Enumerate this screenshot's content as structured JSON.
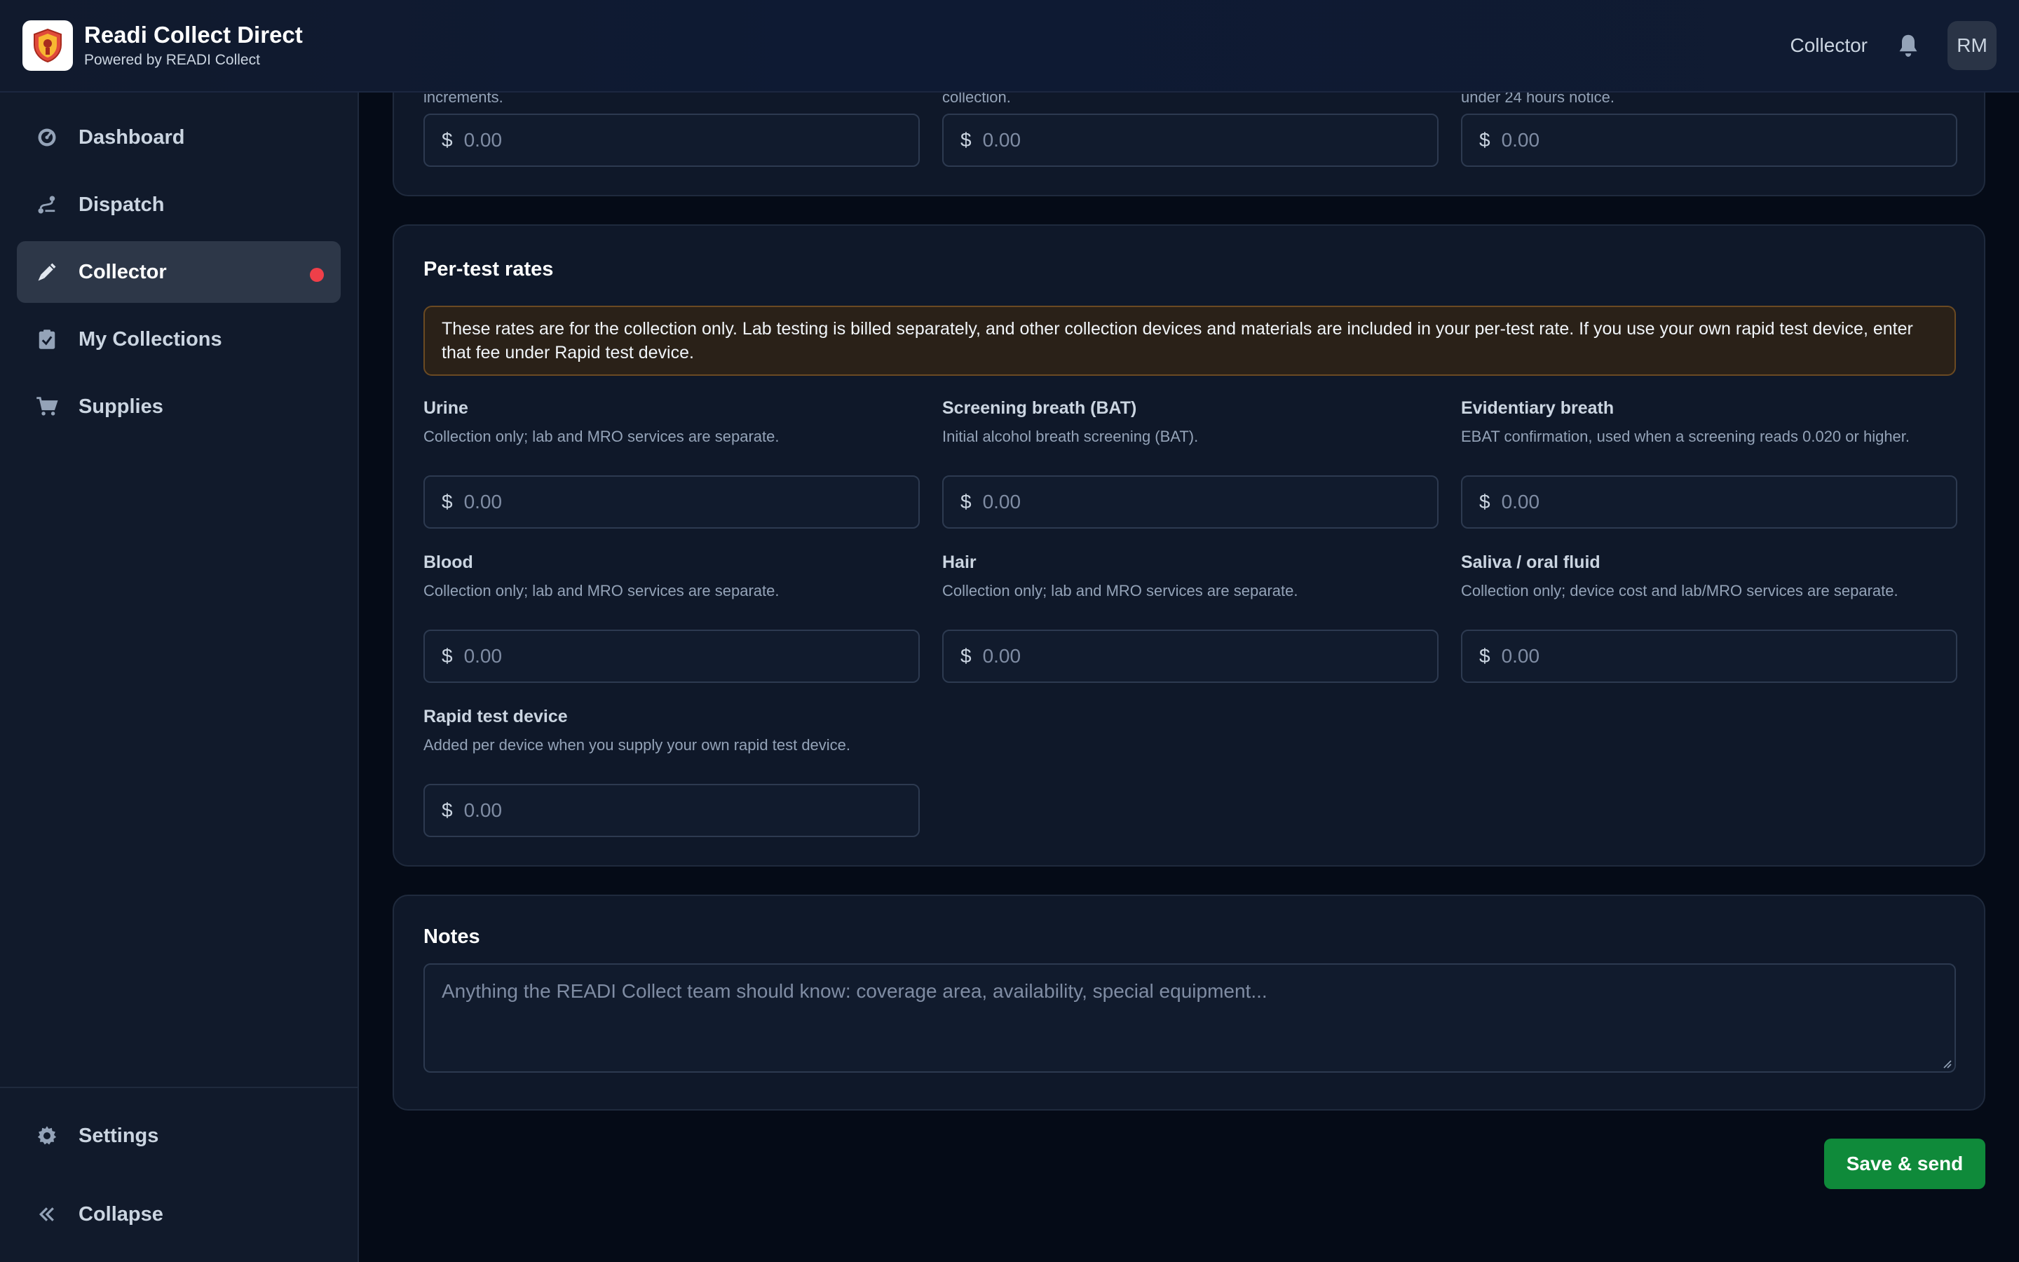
{
  "header": {
    "app_title": "Readi Collect Direct",
    "app_subtitle": "Powered by READI Collect",
    "role": "Collector",
    "avatar_initials": "RM"
  },
  "sidebar": {
    "items": [
      {
        "label": "Dashboard",
        "icon": "gauge-icon"
      },
      {
        "label": "Dispatch",
        "icon": "route-icon"
      },
      {
        "label": "Collector",
        "icon": "syringe-icon",
        "active": true,
        "has_alert_dot": true
      },
      {
        "label": "My Collections",
        "icon": "clipboard-check-icon"
      },
      {
        "label": "Supplies",
        "icon": "cart-icon"
      }
    ],
    "bottom_items": [
      {
        "label": "Settings",
        "icon": "gear-icon"
      },
      {
        "label": "Collapse",
        "icon": "double-chevron-left-icon"
      }
    ]
  },
  "top_section": {
    "help_fragments": [
      "increments.",
      "collection.",
      "under 24 hours notice."
    ],
    "inputs": [
      {
        "currency": "$",
        "placeholder": "0.00"
      },
      {
        "currency": "$",
        "placeholder": "0.00"
      },
      {
        "currency": "$",
        "placeholder": "0.00"
      }
    ]
  },
  "per_test": {
    "title": "Per-test rates",
    "notice": "These rates are for the collection only. Lab testing is billed separately, and other collection devices and materials are included in your per-test rate. If you use your own rapid test device, enter that fee under Rapid test device.",
    "fields": [
      {
        "label": "Urine",
        "help": "Collection only; lab and MRO services are separate.",
        "currency": "$",
        "placeholder": "0.00"
      },
      {
        "label": "Screening breath (BAT)",
        "help": "Initial alcohol breath screening (BAT).",
        "currency": "$",
        "placeholder": "0.00"
      },
      {
        "label": "Evidentiary breath",
        "help": "EBAT confirmation, used when a screening reads 0.020 or higher.",
        "currency": "$",
        "placeholder": "0.00"
      },
      {
        "label": "Blood",
        "help": "Collection only; lab and MRO services are separate.",
        "currency": "$",
        "placeholder": "0.00"
      },
      {
        "label": "Hair",
        "help": "Collection only; lab and MRO services are separate.",
        "currency": "$",
        "placeholder": "0.00"
      },
      {
        "label": "Saliva / oral fluid",
        "help": "Collection only; device cost and lab/MRO services are separate.",
        "currency": "$",
        "placeholder": "0.00"
      },
      {
        "label": "Rapid test device",
        "help": "Added per device when you supply your own rapid test device.",
        "currency": "$",
        "placeholder": "0.00"
      }
    ]
  },
  "notes": {
    "title": "Notes",
    "placeholder": "Anything the READI Collect team should know: coverage area, availability, special equipment..."
  },
  "actions": {
    "save_label": "Save & send"
  },
  "colors": {
    "accent_green": "#0f8a3a",
    "alert_red": "#ef3f49",
    "notice_border": "#6b4a22"
  }
}
